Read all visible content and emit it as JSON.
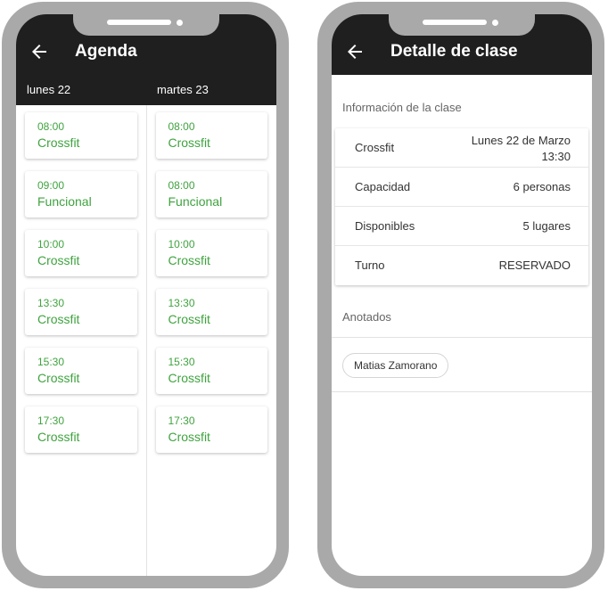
{
  "agenda": {
    "title": "Agenda",
    "days": [
      {
        "label": "lunes 22",
        "classes": [
          {
            "time": "08:00",
            "name": "Crossfit"
          },
          {
            "time": "09:00",
            "name": "Funcional"
          },
          {
            "time": "10:00",
            "name": "Crossfit"
          },
          {
            "time": "13:30",
            "name": "Crossfit"
          },
          {
            "time": "15:30",
            "name": "Crossfit"
          },
          {
            "time": "17:30",
            "name": "Crossfit"
          }
        ]
      },
      {
        "label": "martes 23",
        "classes": [
          {
            "time": "08:00",
            "name": "Crossfit"
          },
          {
            "time": "08:00",
            "name": "Funcional"
          },
          {
            "time": "10:00",
            "name": "Crossfit"
          },
          {
            "time": "13:30",
            "name": "Crossfit"
          },
          {
            "time": "15:30",
            "name": "Crossfit"
          },
          {
            "time": "17:30",
            "name": "Crossfit"
          }
        ]
      }
    ]
  },
  "detalle": {
    "title": "Detalle de clase",
    "info_section": "Información de la clase",
    "rows": [
      {
        "label": "Crossfit",
        "value_line1": "Lunes 22 de Marzo",
        "value_line2": "13:30"
      },
      {
        "label": "Capacidad",
        "value": "6 personas"
      },
      {
        "label": "Disponibles",
        "value": "5 lugares"
      },
      {
        "label": "Turno",
        "value": "RESERVADO"
      }
    ],
    "attendees_section": "Anotados",
    "attendees": [
      "Matias Zamorano"
    ]
  },
  "colors": {
    "appbar": "#1f1f1f",
    "accent_green": "#3fa33f",
    "phone_frame": "#a9a9a9"
  },
  "icons": {
    "back": "arrow-left-icon"
  }
}
